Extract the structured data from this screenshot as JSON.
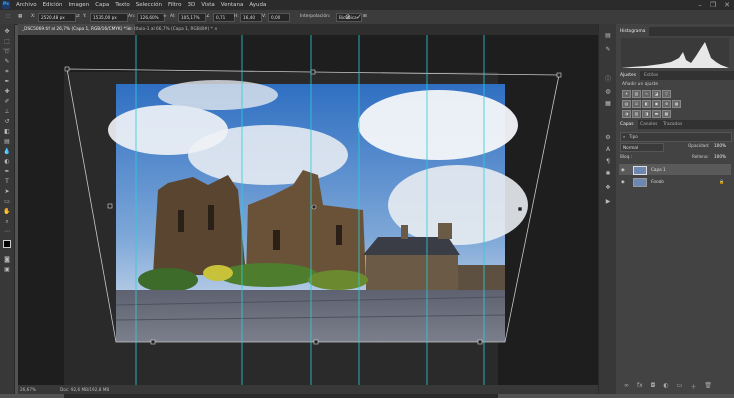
{
  "app": {
    "logo": "Ps"
  },
  "menu": {
    "items": [
      "Archivo",
      "Edición",
      "Imagen",
      "Capa",
      "Texto",
      "Selección",
      "Filtro",
      "3D",
      "Vista",
      "Ventana",
      "Ayuda"
    ]
  },
  "window_controls": {
    "minimize": "–",
    "maximize": "❐",
    "close": "✕"
  },
  "options": {
    "x_label": "X:",
    "x_value": "2520,48 px",
    "y_label": "Y:",
    "y_value": "1535,00 px",
    "w_label": "An:",
    "w_value": "126,60%",
    "h_label": "Al:",
    "h_value": "105,17%",
    "angle_value": "0,71",
    "hskew_label": "H:",
    "hskew_value": "16,40",
    "vskew_label": "V:",
    "vskew_value": "0,00",
    "interp_label": "Interpolación:",
    "interp_value": "Bicúbica",
    "cancel_icon": "⊘",
    "commit_icon": "✓"
  },
  "tabs": [
    {
      "label": "_DSC5069.tif al 26,7% (Capa 1, RGB/16/CMYK) *  ×",
      "active": true
    },
    {
      "label": "Sin título-1 al 66,7% (Capa 1, RGB/8#) *  ×",
      "active": false
    }
  ],
  "status": {
    "zoom": "26,67%",
    "doc": "Doc: 92,6 MB/192,8 MB"
  },
  "panels": {
    "histogram_title": "Histograma",
    "adjust_tabs": [
      "Ajustes",
      "Estilos"
    ],
    "adjust_hint": "Añadir un ajuste",
    "layers_tabs": [
      "Capas",
      "Canales",
      "Trazados"
    ],
    "filter_label": "Tipo",
    "blend_mode": "Normal",
    "opacity_label": "Opacidad:",
    "opacity_value": "100%",
    "lock_label": "Bloq.:",
    "fill_label": "Relleno:",
    "fill_value": "100%",
    "layers": [
      {
        "name": "Capa 1",
        "selected": true
      },
      {
        "name": "Fondo",
        "selected": false
      }
    ]
  }
}
